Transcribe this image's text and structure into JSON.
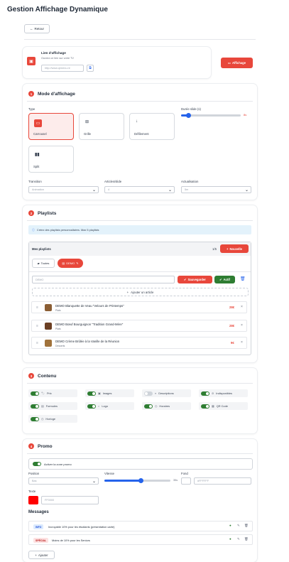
{
  "page": {
    "title": "Gestion Affichage Dynamique",
    "back_label": "Retour"
  },
  "display_link": {
    "label": "Lien d'affichage",
    "subtitle": "Ouvrez ce lien sur votre TV",
    "url_value": "http://www.qrmenu.re",
    "display_button": "Affichage"
  },
  "mode": {
    "number": "1",
    "title": "Mode d'affichage",
    "type_label": "Type",
    "duration_label": "Durée slide (s)",
    "duration_value": "8s",
    "duration_level": 0.12,
    "types": [
      {
        "label": "Carrousel",
        "icon": "carousel-icon",
        "selected": true
      },
      {
        "label": "Grille",
        "icon": "grid-icon",
        "selected": false
      },
      {
        "label": "Défilement",
        "icon": "arrow-down-icon",
        "selected": false
      },
      {
        "label": "Split",
        "icon": "split-icon",
        "selected": false
      }
    ],
    "transition_label": "Transition",
    "transition_value": "Animation",
    "articles_label": "Articles/slide",
    "articles_value": "4",
    "refresh_label": "Actualisation",
    "refresh_value": "5m"
  },
  "playlists": {
    "number": "2",
    "title": "Playlists",
    "info": "Créez des playlists personnalisées. Max 5 playlists",
    "my_label": "Mes playlists",
    "count": "1/5",
    "new_button": "Nouvelle",
    "tabs": [
      {
        "label": "Toutes"
      },
      {
        "label": "DEMO"
      }
    ],
    "name_value": "DEMO",
    "save_button": "Sauvegarder",
    "active_button": "Actif",
    "add_article": "Ajouter un article",
    "items": [
      {
        "name": "DEMO Blanquette de Veau \"Velours de Printemps\"",
        "category": "Plats",
        "price": "28€"
      },
      {
        "name": "DEMO Bœuf Bourguignon \"Tradition Grand-Mère\"",
        "category": "Plats",
        "price": "28€"
      },
      {
        "name": "DEMO Crème Brûlée à la Vanille de la Réunion",
        "category": "Desserts",
        "price": "9€"
      }
    ]
  },
  "content": {
    "number": "3",
    "title": "Contenu",
    "toggles": [
      {
        "label": "Prix",
        "icon": "tag-icon",
        "on": true
      },
      {
        "label": "Images",
        "icon": "image-icon",
        "on": true
      },
      {
        "label": "Descriptions",
        "icon": "text-icon",
        "on": false
      },
      {
        "label": "Indisponibles",
        "icon": "unavailable-icon",
        "on": true
      },
      {
        "label": "Formules",
        "icon": "formula-icon",
        "on": true
      },
      {
        "label": "Logo",
        "icon": "store-icon",
        "on": true
      },
      {
        "label": "Horaires",
        "icon": "clock-icon",
        "on": true
      },
      {
        "label": "QR Code",
        "icon": "qr-icon",
        "on": true
      },
      {
        "label": "Horloge",
        "icon": "clock-icon",
        "on": true
      }
    ]
  },
  "promo": {
    "number": "4",
    "title": "Promo",
    "enable_label": "Activer la zone promo",
    "position_label": "Position",
    "position_value": "Bas",
    "speed_label": "Vitesse",
    "speed_value": "35s",
    "speed_level": 0.55,
    "bg_label": "Fond",
    "bg_value": "#FFFFFF",
    "text_label": "Texte",
    "text_color": "#FF0000",
    "text_value": "FF0000",
    "messages_title": "Messages",
    "messages": [
      {
        "badge": "INFO",
        "text": "Incroyable 10% pour les étudiants (présentation carte)"
      },
      {
        "badge": "SPÉCIAL",
        "text": "Moins de 10% pour les Seniors"
      }
    ],
    "add_button": "Ajouter"
  },
  "colors": {
    "accent": "#e8473b",
    "green": "#2e7d32",
    "blue": "#2563eb"
  }
}
